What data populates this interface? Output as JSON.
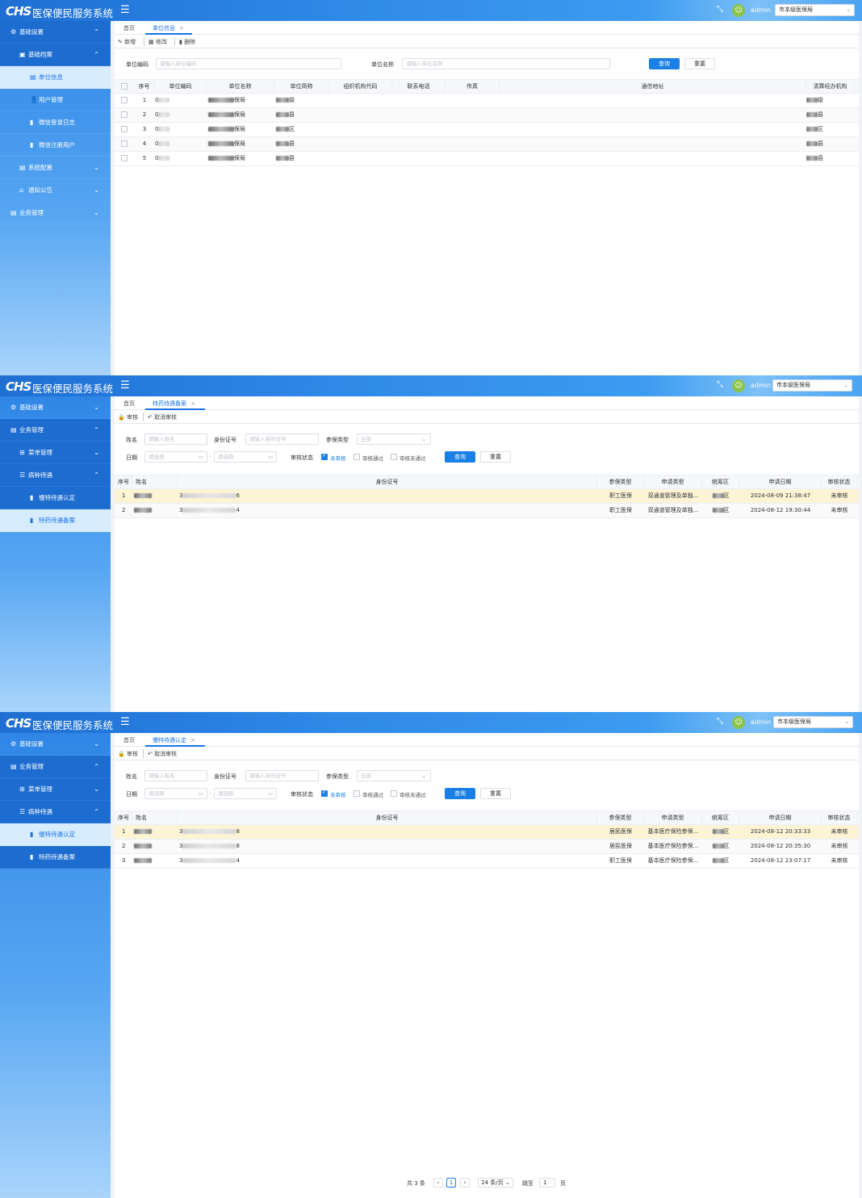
{
  "app": {
    "logo": "CHS",
    "title": "医保便民服务系统",
    "user": "admin",
    "org": "市本级医保局"
  },
  "panel1": {
    "sidebar": [
      {
        "label": "基础设置",
        "icon": "⚙",
        "arrow": "⌃",
        "lvl": 0,
        "dark": true
      },
      {
        "label": "基础档案",
        "icon": "▣",
        "arrow": "⌃",
        "lvl": 1,
        "dark": true
      },
      {
        "label": "单位信息",
        "icon": "▤",
        "arrow": "",
        "lvl": 2,
        "active": true
      },
      {
        "label": "用户管理",
        "icon": "👤",
        "arrow": "",
        "lvl": 2
      },
      {
        "label": "微信登录日志",
        "icon": "▮",
        "arrow": "",
        "lvl": 2
      },
      {
        "label": "微信注册用户",
        "icon": "▮",
        "arrow": "",
        "lvl": 2
      },
      {
        "label": "系统配置",
        "icon": "▤",
        "arrow": "⌄",
        "lvl": 1
      },
      {
        "label": "通知公告",
        "icon": "⌂",
        "arrow": "⌄",
        "lvl": 1
      },
      {
        "label": "业务管理",
        "icon": "▤",
        "arrow": "⌄",
        "lvl": 0
      }
    ],
    "tabs": [
      "首页",
      "单位信息"
    ],
    "toolbar": {
      "add": "新增",
      "edit": "修改",
      "del": "删除"
    },
    "search": {
      "code_label": "单位编码",
      "code_ph": "请输入单位编码",
      "name_label": "单位名称",
      "name_ph": "请输入单位名称",
      "query": "查询",
      "reset": "重置"
    },
    "columns": [
      "序号",
      "单位编码",
      "单位名称",
      "单位简称",
      "组织机构代码",
      "联系电话",
      "传真",
      "通信地址",
      "清算经办机构"
    ],
    "rows": [
      {
        "no": "1",
        "code": "0",
        "name": "保局",
        "short": "级",
        "agency": "级"
      },
      {
        "no": "2",
        "code": "0",
        "name": "保局",
        "short": "县",
        "agency": "县"
      },
      {
        "no": "3",
        "code": "0",
        "name": "保局",
        "short": "区",
        "agency": "区"
      },
      {
        "no": "4",
        "code": "0",
        "name": "保局",
        "short": "县",
        "agency": "县"
      },
      {
        "no": "5",
        "code": "0",
        "name": "保局",
        "short": "县",
        "agency": "县"
      }
    ]
  },
  "panel2": {
    "sidebar": [
      {
        "label": "基础设置",
        "icon": "⚙",
        "arrow": "⌄",
        "lvl": 0
      },
      {
        "label": "业务管理",
        "icon": "▤",
        "arrow": "⌃",
        "lvl": 0,
        "dark": true
      },
      {
        "label": "菜单管理",
        "icon": "⊞",
        "arrow": "⌄",
        "lvl": 1,
        "dark": true
      },
      {
        "label": "病种待遇",
        "icon": "☰",
        "arrow": "⌃",
        "lvl": 1,
        "dark": true
      },
      {
        "label": "慢特待遇认定",
        "icon": "▮",
        "arrow": "",
        "lvl": 2,
        "dark": true
      },
      {
        "label": "特药待遇备案",
        "icon": "▮",
        "arrow": "",
        "lvl": 2,
        "active": true
      }
    ],
    "tabs": [
      "首页",
      "特药待遇备案"
    ],
    "toolbar": {
      "audit": "审核",
      "cancel": "取消审核"
    },
    "search": {
      "name_label": "姓名",
      "name_ph": "请输入姓名",
      "id_label": "身份证号",
      "id_ph": "请输入身份证号",
      "type_label": "参保类型",
      "type_val": "全部",
      "date_label": "日期",
      "date_ph": "请选择",
      "status_label": "审核状态",
      "s1": "未审核",
      "s2": "审核通过",
      "s3": "审核未通过",
      "query": "查询",
      "reset": "重置"
    },
    "columns": [
      "序号",
      "姓名",
      "身份证号",
      "参保类型",
      "申请类型",
      "统筹区",
      "申请日期",
      "审核状态"
    ],
    "rows": [
      {
        "no": "1",
        "id_a": "3",
        "id_b": "6",
        "ins": "职工医保",
        "apply": "双通道管理及单独...",
        "area": "区",
        "date": "2024-08-09 21:38:47",
        "status": "未审核"
      },
      {
        "no": "2",
        "id_a": "3",
        "id_b": "4",
        "ins": "职工医保",
        "apply": "双通道管理及单独...",
        "area": "区",
        "date": "2024-08-12 19:30:44",
        "status": "未审核"
      }
    ]
  },
  "panel3": {
    "sidebar": [
      {
        "label": "基础设置",
        "icon": "⚙",
        "arrow": "⌄",
        "lvl": 0
      },
      {
        "label": "业务管理",
        "icon": "▤",
        "arrow": "⌃",
        "lvl": 0,
        "dark": true
      },
      {
        "label": "菜单管理",
        "icon": "⊞",
        "arrow": "⌄",
        "lvl": 1,
        "dark": true
      },
      {
        "label": "病种待遇",
        "icon": "☰",
        "arrow": "⌃",
        "lvl": 1,
        "dark": true
      },
      {
        "label": "慢特待遇认定",
        "icon": "▮",
        "arrow": "",
        "lvl": 2,
        "active": true
      },
      {
        "label": "特药待遇备案",
        "icon": "▮",
        "arrow": "",
        "lvl": 2,
        "dark": true
      }
    ],
    "tabs": [
      "首页",
      "慢特待遇认定"
    ],
    "toolbar": {
      "audit": "审核",
      "cancel": "取消审核"
    },
    "search": {
      "name_label": "姓名",
      "name_ph": "请输入姓名",
      "id_label": "身份证号",
      "id_ph": "请输入身份证号",
      "type_label": "参保类型",
      "type_val": "全部",
      "date_label": "日期",
      "date_ph": "请选择",
      "status_label": "审核状态",
      "s1": "未审核",
      "s2": "审核通过",
      "s3": "审核未通过",
      "query": "查询",
      "reset": "重置"
    },
    "columns": [
      "序号",
      "姓名",
      "身份证号",
      "参保类型",
      "申请类型",
      "统筹区",
      "申请日期",
      "审核状态"
    ],
    "rows": [
      {
        "no": "1",
        "id_a": "3",
        "id_b": "8",
        "ins": "居民医保",
        "apply": "基本医疗保险参保...",
        "area": "区",
        "date": "2024-08-12 20:33:33",
        "status": "未审核"
      },
      {
        "no": "2",
        "id_a": "3",
        "id_b": "8",
        "ins": "居民医保",
        "apply": "基本医疗保险参保...",
        "area": "区",
        "date": "2024-08-12 20:35:30",
        "status": "未审核"
      },
      {
        "no": "3",
        "id_a": "3",
        "id_b": "4",
        "ins": "职工医保",
        "apply": "基本医疗保险参保...",
        "area": "区",
        "date": "2024-08-12 23:07:17",
        "status": "未审核"
      }
    ],
    "pager": {
      "total": "共 3 条",
      "page": "1",
      "size": "24 条/页",
      "jump": "跳至",
      "jump_val": "1",
      "unit": "页"
    }
  }
}
